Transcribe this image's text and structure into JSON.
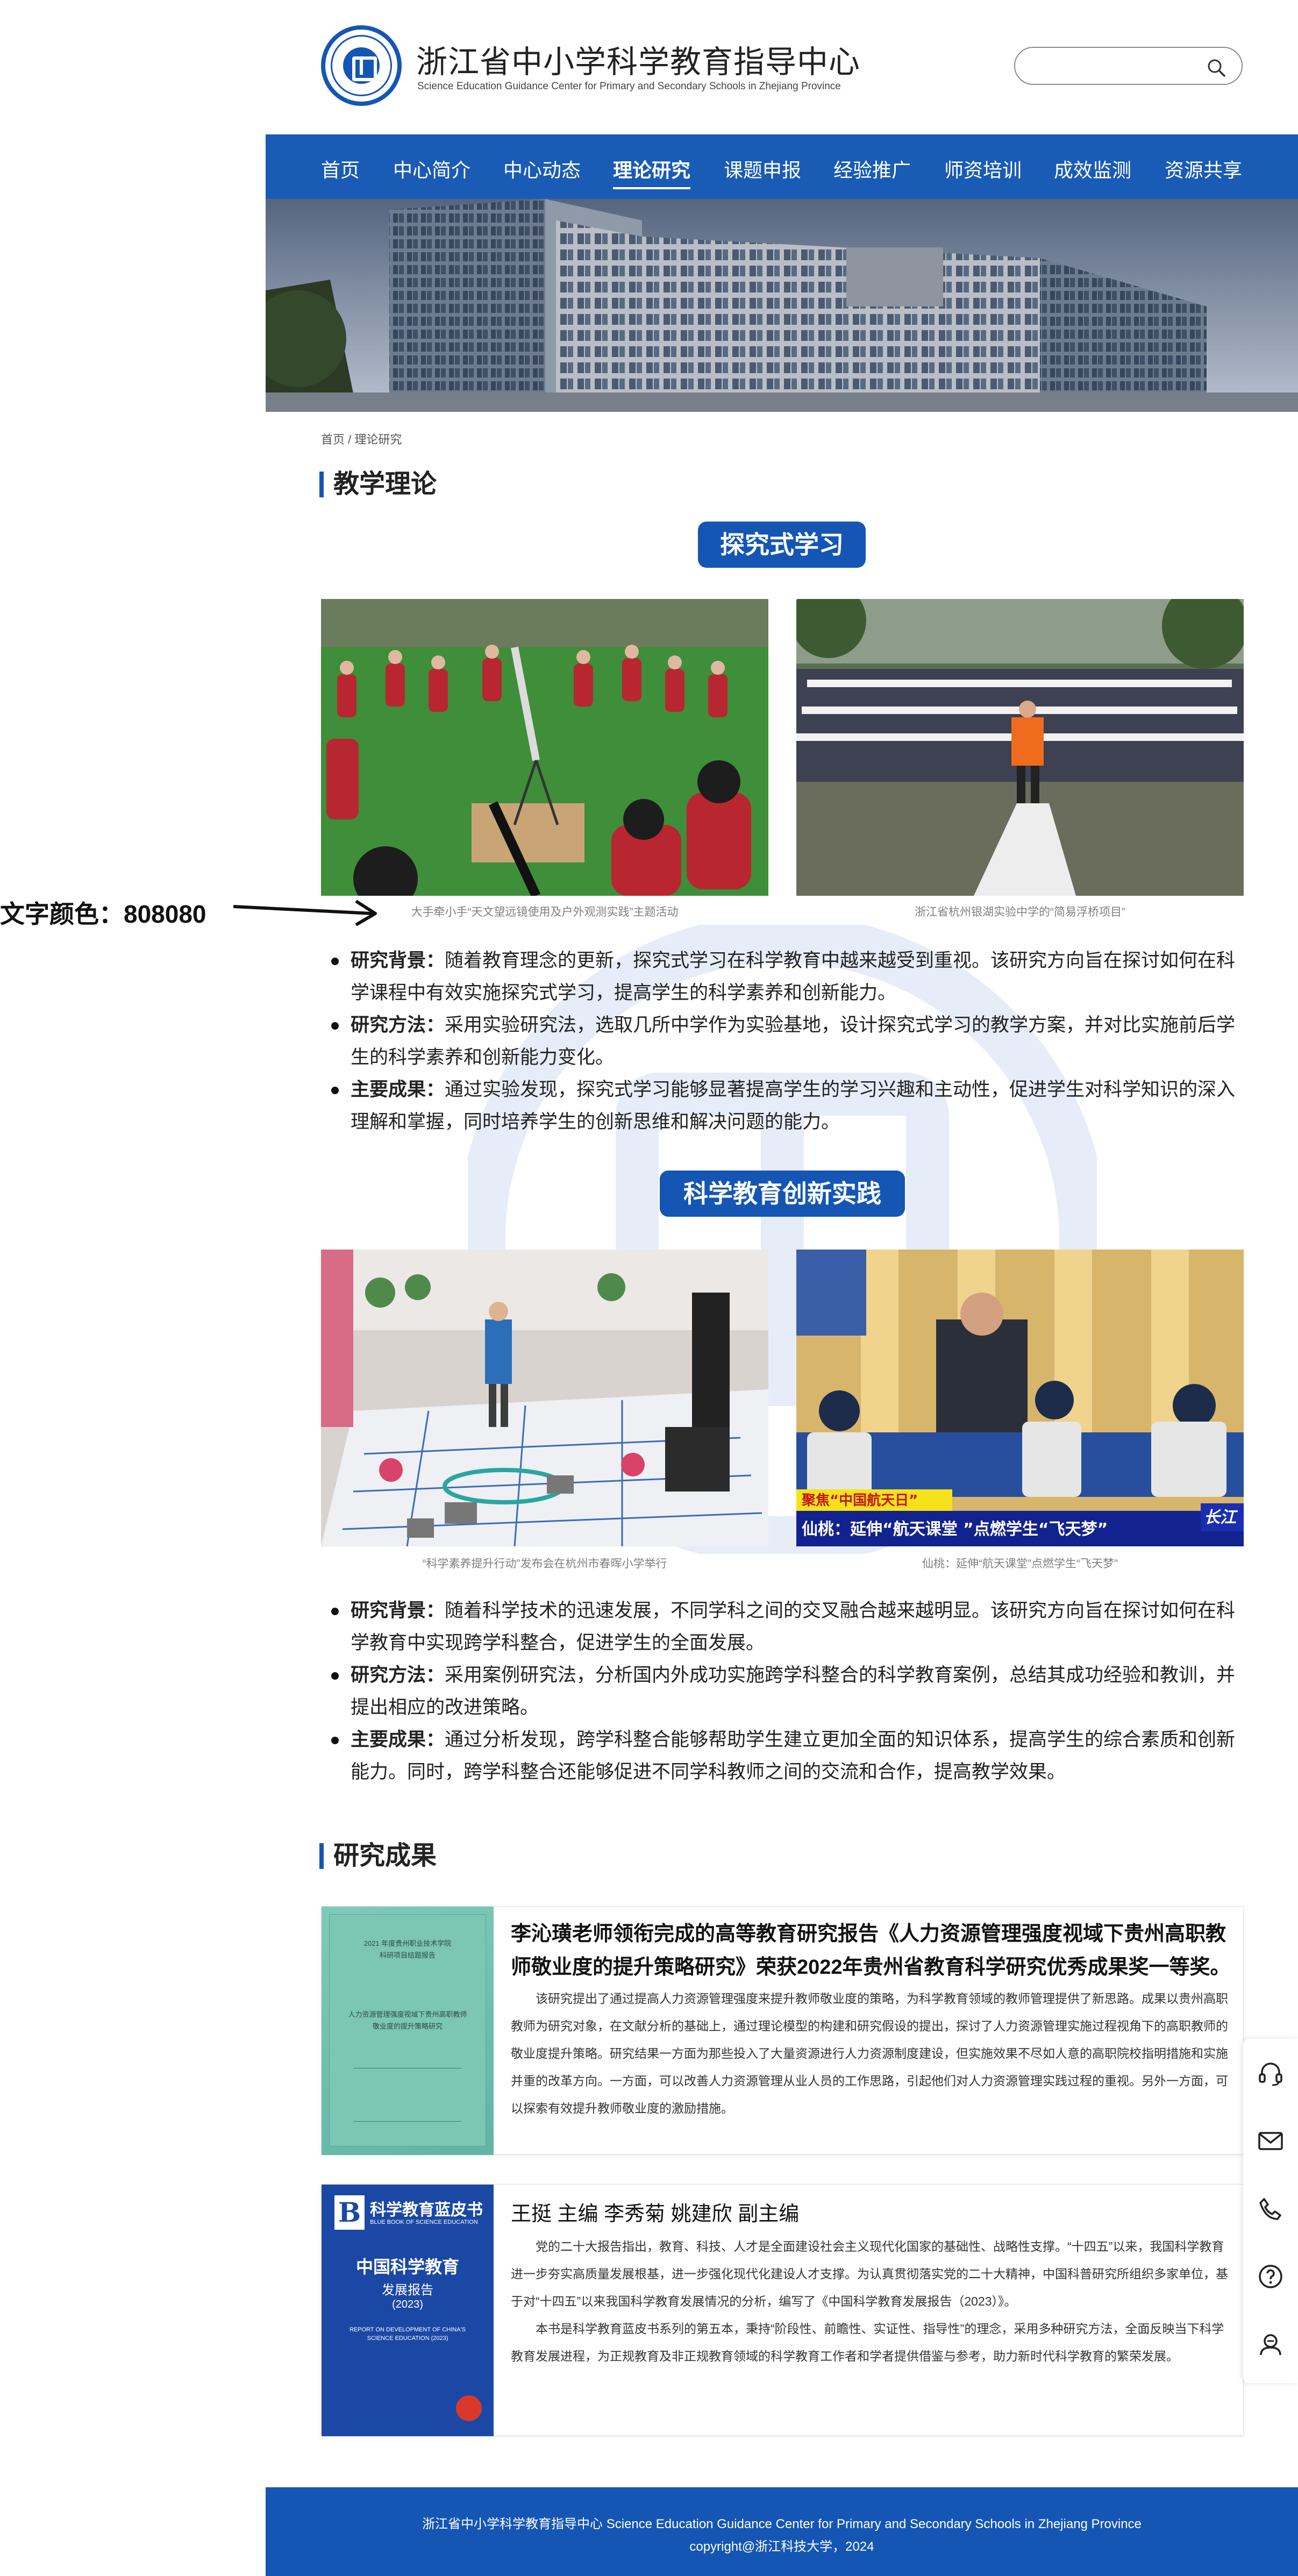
{
  "header": {
    "title": "浙江省中小学科学教育指导中心",
    "subtitle": "Science Education Guidance Center for Primary and Secondary Schools in Zhejiang Province",
    "search_placeholder": ""
  },
  "nav": {
    "items": [
      {
        "label": "首页"
      },
      {
        "label": "中心简介"
      },
      {
        "label": "中心动态"
      },
      {
        "label": "理论研究"
      },
      {
        "label": "课题申报"
      },
      {
        "label": "经验推广"
      },
      {
        "label": "师资培训"
      },
      {
        "label": "成效监测"
      },
      {
        "label": "资源共享"
      }
    ],
    "active": "理论研究"
  },
  "breadcrumb": {
    "home": "首页",
    "sep": "/",
    "current": "理论研究"
  },
  "theory": {
    "heading": "教学理论",
    "block1": {
      "pill": "探究式学习",
      "captions": [
        "大手牵小手“天文望远镜使用及户外观测实践”主题活动",
        "浙江省杭州银湖实验中学的“简易浮桥项目”"
      ],
      "bullets": [
        {
          "label": "研究背景：",
          "text": "随着教育理念的更新，探究式学习在科学教育中越来越受到重视。该研究方向旨在探讨如何在科学课程中有效实施探究式学习，提高学生的科学素养和创新能力。"
        },
        {
          "label": "研究方法：",
          "text": "采用实验研究法，选取几所中学作为实验基地，设计探究式学习的教学方案，并对比实施前后学生的科学素养和创新能力变化。"
        },
        {
          "label": "主要成果：",
          "text": "通过实验发现，探究式学习能够显著提高学生的学习兴趣和主动性，促进学生对科学知识的深入理解和掌握，同时培养学生的创新思维和解决问题的能力。"
        }
      ]
    },
    "block2": {
      "pill": "科学教育创新实践",
      "captions": [
        "“科学素养提升行动”发布会在杭州市春晖小学举行",
        "仙桃：延伸“航天课堂”点燃学生“飞天梦”"
      ],
      "tv_tag": "聚焦“中国航天日”",
      "tv_headline": "仙桃：延伸“航天课堂 ”点燃学生“飞天梦”",
      "tv_logo": "长江",
      "bullets": [
        {
          "label": "研究背景：",
          "text": "随着科学技术的迅速发展，不同学科之间的交叉融合越来越明显。该研究方向旨在探讨如何在科学教育中实现跨学科整合，促进学生的全面发展。"
        },
        {
          "label": "研究方法：",
          "text": "采用案例研究法，分析国内外成功实施跨学科整合的科学教育案例，总结其成功经验和教训，并提出相应的改进策略。"
        },
        {
          "label": "主要成果：",
          "text": "通过分析发现，跨学科整合能够帮助学生建立更加全面的知识体系，提高学生的综合素质和创新能力。同时，跨学科整合还能够促进不同学科教师之间的交流和合作，提高教学效果。"
        }
      ]
    }
  },
  "annotation": {
    "text": "文字颜色：808080"
  },
  "results": {
    "heading": "研究成果",
    "items": [
      {
        "title": "李沁璜老师领衔完成的高等教育研究报告《人力资源管理强度视域下贵州高职教师敬业度的提升策略研究》荣获2022年贵州省教育科学研究优秀成果奖一等奖。",
        "paragraphs": [
          "该研究提出了通过提高人力资源管理强度来提升教师敬业度的策略，为科学教育领域的教师管理提供了新思路。成果以贵州高职教师为研究对象，在文献分析的基础上，通过理论模型的构建和研究假设的提出，探讨了人力资源管理实施过程视角下的高职教师的敬业度提升策略。研究结果一方面为那些投入了大量资源进行人力资源制度建设，但实施效果不尽如人意的高职院校指明措施和实施并重的改革方向。一方面，可以改善人力资源管理从业人员的工作思路，引起他们对人力资源管理实践过程的重视。另外一方面，可以探索有效提升教师敬业度的激励措施。"
        ],
        "cover": {
          "lines": [
            "2021 年度贵州职业技术学院",
            "科研项目结题报告",
            "人力资源管理强度视域下贵州高职教师",
            "敬业度的提升策略研究"
          ]
        }
      },
      {
        "title": "王挺  主编     李秀菊 姚建欣  副主编",
        "paragraphs": [
          "党的二十大报告指出，教育、科技、人才是全面建设社会主义现代化国家的基础性、战略性支撑。“十四五”以来，我国科学教育进一步夯实高质量发展根基，进一步强化现代化建设人才支撑。为认真贯彻落实党的二十大精神，中国科普研究所组织多家单位，基于对“十四五”以来我国科学教育发展情况的分析，编写了《中国科学教育发展报告（2023）》。",
          "本书是科学教育蓝皮书系列的第五本，秉持“阶段性、前瞻性、实证性、指导性”的理念，采用多种研究方法，全面反映当下科学教育发展进程，为正规教育及非正规教育领域的科学教育工作者和学者提供借鉴与参考，助力新时代科学教育的繁荣发展。"
        ],
        "cover": {
          "brand": "科学教育蓝皮书",
          "brand_en": "BLUE BOOK OF SCIENCE EDUCATION",
          "title": "中国科学教育",
          "title2": "发展报告",
          "year": "(2023)",
          "en": "REPORT ON DEVELOPMENT OF CHINA'S SCIENCE EDUCATION (2023)"
        }
      }
    ]
  },
  "side_tools": [
    "headset-icon",
    "mail-icon",
    "phone-icon",
    "help-icon",
    "chat-icon"
  ],
  "footer": {
    "line1": "浙江省中小学科学教育指导中心  Science Education Guidance Center for Primary and Secondary Schools in Zhejiang Province",
    "line2": "copyright@浙江科技大学，2024"
  },
  "colors": {
    "brand": "#1556b4",
    "caption": "#808080"
  }
}
